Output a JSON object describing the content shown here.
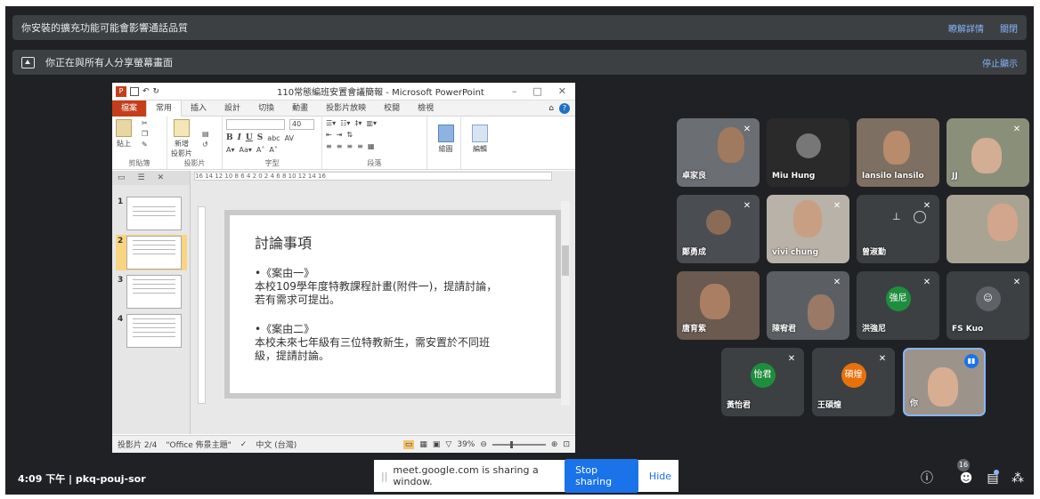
{
  "banners": {
    "extension_warning": "你安裝的擴充功能可能會影響通話品質",
    "learn_more": "瞭解詳情",
    "close": "關閉",
    "sharing_notice": "你正在與所有人分享螢幕畫面",
    "stop_presenting": "停止顯示"
  },
  "powerpoint": {
    "window_title": "110常態編班安置會議簡報 - Microsoft PowerPoint",
    "app_icon": "P",
    "ribbon_tabs": [
      "檔案",
      "常用",
      "插入",
      "設計",
      "切換",
      "動畫",
      "投影片放映",
      "校閱",
      "檢視"
    ],
    "groups": {
      "clipboard": "剪貼簿",
      "paste": "貼上",
      "slides": "投影片",
      "new_slide": "新增",
      "new_slide_2": "投影片",
      "font": "字型",
      "font_size": "40",
      "paragraph": "段落",
      "drawing": "繪圖",
      "editing": "編輯"
    },
    "ruler_text": "16 14 12 10 8 6 4 2 0 2 4 6 8 10 12 14 16",
    "thumbnail_numbers": [
      "1",
      "2",
      "3",
      "4"
    ],
    "slide": {
      "heading": "討論事項",
      "item1_title": "•《案由一》",
      "item1_line1": "本校109學年度特教課程計畫(附件一)，提請討論，",
      "item1_line2": "若有需求可提出。",
      "item2_title": "•《案由二》",
      "item2_line1": "本校未來七年級有三位特教新生，需安置於不同班",
      "item2_line2": "級，提請討論。"
    },
    "status": {
      "slide_position": "投影片 2/4",
      "theme": "\"Office 佈景主題\"",
      "language": "中文 (台灣)",
      "zoom": "39%"
    }
  },
  "participants": [
    {
      "name": "卓家良",
      "type": "video"
    },
    {
      "name": "Miu Hung",
      "type": "video"
    },
    {
      "name": "lansilo lansilo",
      "type": "video"
    },
    {
      "name": "JJ",
      "type": "video"
    },
    {
      "name": "鄭勇成",
      "type": "video"
    },
    {
      "name": "vivi chung",
      "type": "video"
    },
    {
      "name": "曾淑勤",
      "type": "video"
    },
    {
      "name": "",
      "type": "video"
    },
    {
      "name": "唐育紫",
      "type": "video"
    },
    {
      "name": "陳宥君",
      "type": "video"
    },
    {
      "name": "洪強尼",
      "type": "avatar",
      "initials": "強尼",
      "color": "#1e8e3e"
    },
    {
      "name": "FS Kuo",
      "type": "avatar"
    },
    {
      "name": "黃怡君",
      "type": "avatar",
      "initials": "怡君",
      "color": "#1e8e3e"
    },
    {
      "name": "王碩煌",
      "type": "avatar",
      "initials": "碩煌",
      "color": "#e8710a"
    },
    {
      "name": "你",
      "type": "video"
    }
  ],
  "bottom_bar": {
    "meeting_info": "4:09 下午 | pkq-pouj-sor",
    "share_message": "meet.google.com is sharing a window.",
    "stop_sharing": "Stop sharing",
    "hide": "Hide",
    "participant_count": "16"
  }
}
